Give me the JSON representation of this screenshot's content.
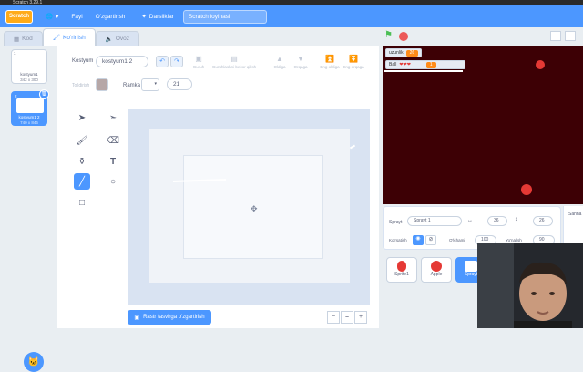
{
  "window": {
    "title": "Scratch 3.29.1"
  },
  "menubar": {
    "logo": "Scratch",
    "file": "Fayl",
    "edit": "O'zgartirish",
    "tutorials": "Darsliklar",
    "project_title": "Scratch loyihasi"
  },
  "tabs": [
    {
      "label": "Kod"
    },
    {
      "label": "Ko'rinish"
    },
    {
      "label": "Ovoz"
    }
  ],
  "costumes": [
    {
      "num": "1",
      "name": "kostyum1",
      "size": "342 x 300"
    },
    {
      "num": "2",
      "name": "kostyum1 2",
      "size": "740 x 846"
    }
  ],
  "editor": {
    "costume_label": "Kostyum",
    "costume_name": "kostyum1 2",
    "fill_label": "To'ldirish",
    "outline_label": "Ramka",
    "outline_width": "21",
    "group": "Guruh",
    "ungroup": "Guruhlashni bekor qilish",
    "forward": "Oldiga",
    "backward": "Orqaga",
    "front": "Eng oldiga",
    "back": "Eng orqaga",
    "convert_btn": "Rastr tasvirga o'zgartirish"
  },
  "stage": {
    "monitors": [
      {
        "label": "uzunlik",
        "value": "26"
      },
      {
        "label": "Ball",
        "hearts": "❤❤❤",
        "value": "1"
      }
    ]
  },
  "sprite_info": {
    "sprite_label": "Sprayt",
    "sprite_name": "Sprayt 1",
    "x": "36",
    "y": "26",
    "show_label": "Ko'rsatish",
    "size_label": "O'lchami",
    "size": "100",
    "direction_label": "Yo'nalish",
    "direction": "90"
  },
  "sprites": [
    {
      "name": "Sprite1"
    },
    {
      "name": "Apple"
    },
    {
      "name": "Sprayt"
    }
  ],
  "stage_panel": {
    "label": "Sahna"
  }
}
